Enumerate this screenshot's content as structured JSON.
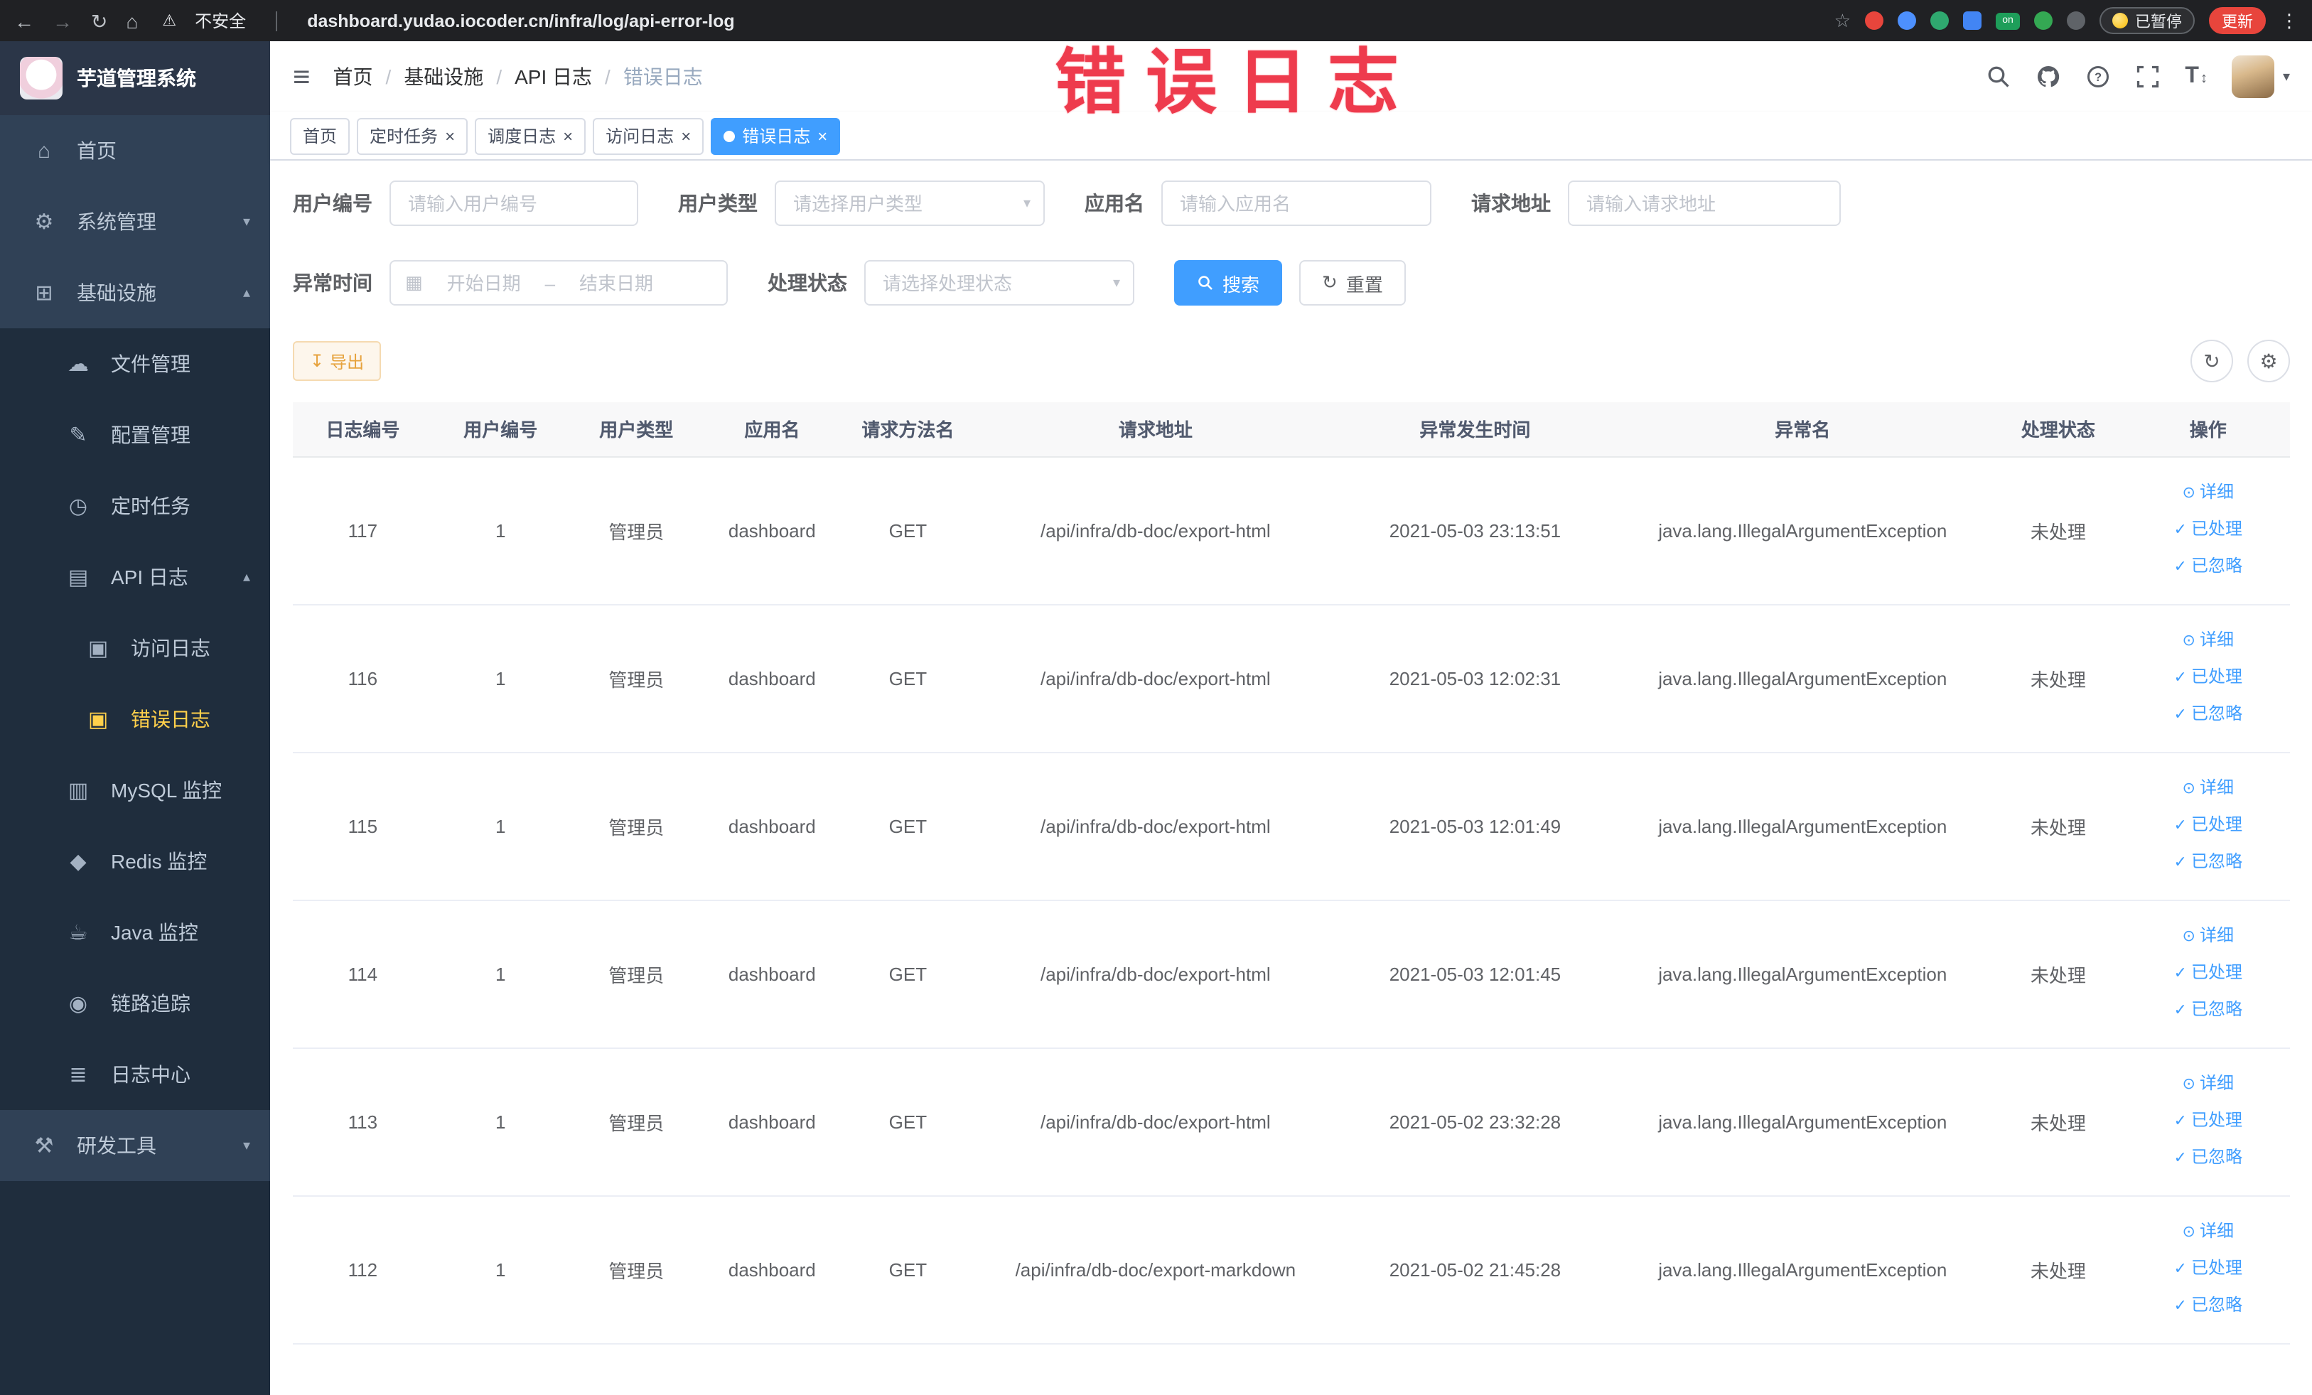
{
  "browser": {
    "security_text": "不安全",
    "url": "dashboard.yudao.iocoder.cn/infra/log/api-error-log",
    "on_label": "on",
    "paused_label": "已暂停",
    "update_label": "更新"
  },
  "watermark": "错误日志",
  "colors": {
    "accent": "#409eff",
    "warning": "#e6a23c",
    "sidebar_active": "#ffd04b",
    "watermark_red": "#ee3b4d"
  },
  "ui": {
    "back": "←",
    "forward": "→",
    "reload": "↻",
    "home": "⌂",
    "star": "☆",
    "warning": "⚠",
    "more": "⋮",
    "hamburger": "≡",
    "close": "×",
    "chevron_down": "▾",
    "chevron_up": "▴",
    "calendar": "▦",
    "eye": "⊙",
    "check": "✓",
    "refresh": "↻",
    "gear": "⚙",
    "download": "↧",
    "font_size_T": "T",
    "updown": "↕"
  },
  "sidebar": {
    "logo_title": "芋道管理系统",
    "home": "首页",
    "system": "系统管理",
    "infra": "基础设施",
    "file": "文件管理",
    "config": "配置管理",
    "job": "定时任务",
    "api_log": "API 日志",
    "access_log": "访问日志",
    "error_log": "错误日志",
    "mysql": "MySQL 监控",
    "redis": "Redis 监控",
    "java": "Java 监控",
    "trace": "链路追踪",
    "log_center": "日志中心",
    "dev_tools": "研发工具",
    "icons": {
      "home": "⌂",
      "system": "⚙",
      "infra": "⊞",
      "file": "☁",
      "config": "✎",
      "job": "◷",
      "api_log": "▤",
      "access_log": "▣",
      "error_log": "▣",
      "mysql": "▥",
      "redis": "◆",
      "java": "☕",
      "trace": "◉",
      "log_center": "≣",
      "dev_tools": "⚒"
    }
  },
  "breadcrumb": {
    "items": [
      "首页",
      "基础设施",
      "API 日志",
      "错误日志"
    ],
    "separator": "/"
  },
  "tabs": [
    {
      "label": "首页"
    },
    {
      "label": "定时任务"
    },
    {
      "label": "调度日志"
    },
    {
      "label": "访问日志"
    },
    {
      "label": "错误日志"
    }
  ],
  "filters": {
    "user_id": {
      "label": "用户编号",
      "placeholder": "请输入用户编号"
    },
    "user_type": {
      "label": "用户类型",
      "placeholder": "请选择用户类型"
    },
    "app_name": {
      "label": "应用名",
      "placeholder": "请输入应用名"
    },
    "request_url": {
      "label": "请求地址",
      "placeholder": "请输入请求地址"
    },
    "exception_time": {
      "label": "异常时间",
      "start_placeholder": "开始日期",
      "end_placeholder": "结束日期",
      "separator": "–"
    },
    "process_status": {
      "label": "处理状态",
      "placeholder": "请选择处理状态"
    },
    "search_label": "搜索",
    "reset_label": "重置"
  },
  "toolbar": {
    "export_label": "导出"
  },
  "table": {
    "columns": [
      "日志编号",
      "用户编号",
      "用户类型",
      "应用名",
      "请求方法名",
      "请求地址",
      "异常发生时间",
      "异常名",
      "处理状态",
      "操作"
    ],
    "actions": [
      "详细",
      "已处理",
      "已忽略"
    ],
    "rows": [
      {
        "id": "117",
        "user_id": "1",
        "user_type": "管理员",
        "app": "dashboard",
        "method": "GET",
        "url": "/api/infra/db-doc/export-html",
        "time": "2021-05-03 23:13:51",
        "exception": "java.lang.IllegalArgumentException",
        "status": "未处理"
      },
      {
        "id": "116",
        "user_id": "1",
        "user_type": "管理员",
        "app": "dashboard",
        "method": "GET",
        "url": "/api/infra/db-doc/export-html",
        "time": "2021-05-03 12:02:31",
        "exception": "java.lang.IllegalArgumentException",
        "status": "未处理"
      },
      {
        "id": "115",
        "user_id": "1",
        "user_type": "管理员",
        "app": "dashboard",
        "method": "GET",
        "url": "/api/infra/db-doc/export-html",
        "time": "2021-05-03 12:01:49",
        "exception": "java.lang.IllegalArgumentException",
        "status": "未处理"
      },
      {
        "id": "114",
        "user_id": "1",
        "user_type": "管理员",
        "app": "dashboard",
        "method": "GET",
        "url": "/api/infra/db-doc/export-html",
        "time": "2021-05-03 12:01:45",
        "exception": "java.lang.IllegalArgumentException",
        "status": "未处理"
      },
      {
        "id": "113",
        "user_id": "1",
        "user_type": "管理员",
        "app": "dashboard",
        "method": "GET",
        "url": "/api/infra/db-doc/export-html",
        "time": "2021-05-02 23:32:28",
        "exception": "java.lang.IllegalArgumentException",
        "status": "未处理"
      },
      {
        "id": "112",
        "user_id": "1",
        "user_type": "管理员",
        "app": "dashboard",
        "method": "GET",
        "url": "/api/infra/db-doc/export-markdown",
        "time": "2021-05-02 21:45:28",
        "exception": "java.lang.IllegalArgumentException",
        "status": "未处理"
      }
    ]
  }
}
